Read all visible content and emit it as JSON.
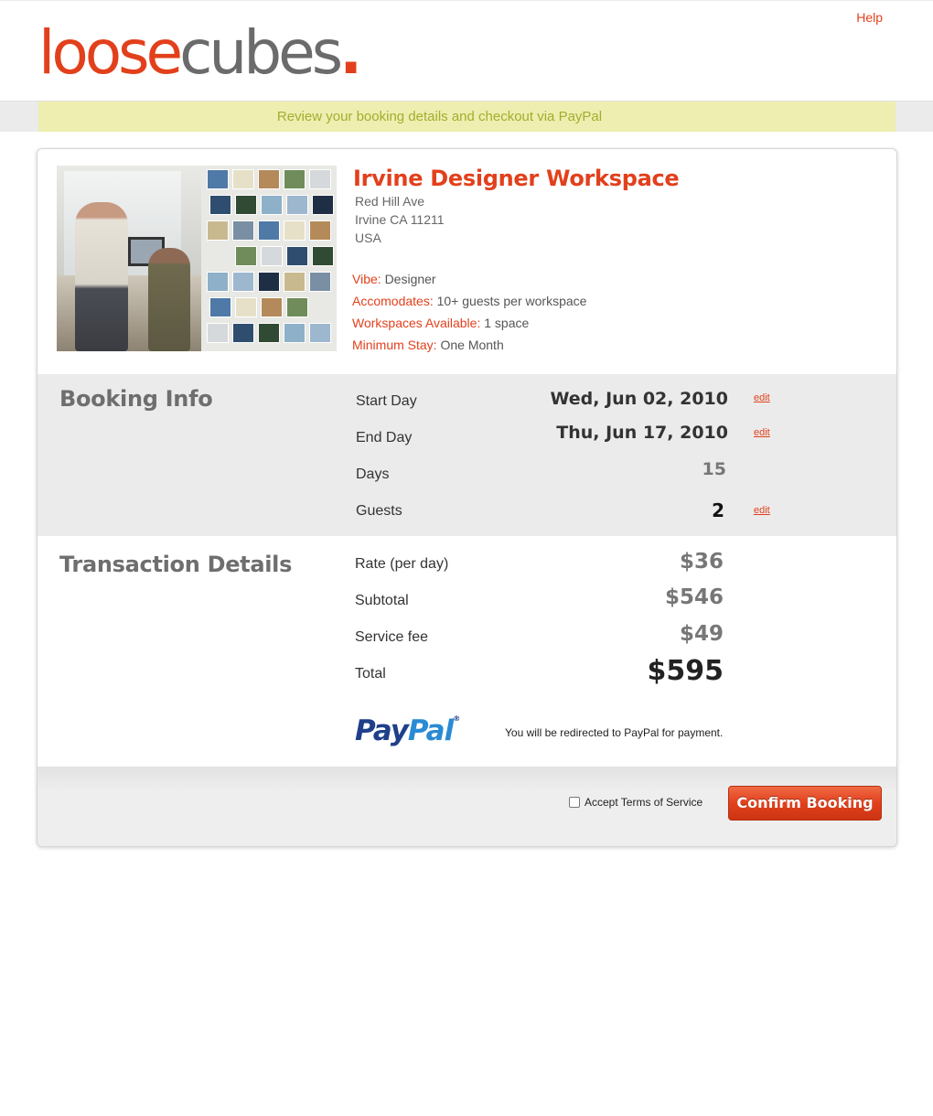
{
  "header": {
    "help_label": "Help",
    "logo": {
      "part1": "loose",
      "part2": "cubes",
      "dot": "."
    }
  },
  "notice": "Review your booking details and checkout via PayPal",
  "listing": {
    "title": "Irvine Designer Workspace",
    "address": [
      "Red Hill Ave",
      "Irvine CA 11211",
      "USA"
    ],
    "attributes": [
      {
        "key": "Vibe:",
        "value": "Designer"
      },
      {
        "key": "Accomodates:",
        "value": "10+ guests per workspace"
      },
      {
        "key": "Workspaces Available:",
        "value": "1 space"
      },
      {
        "key": "Minimum Stay:",
        "value": "One Month"
      }
    ]
  },
  "booking_info": {
    "heading": "Booking Info",
    "rows": [
      {
        "label": "Start Day",
        "value": "Wed, Jun 02, 2010",
        "edit": "edit"
      },
      {
        "label": "End Day",
        "value": "Thu, Jun 17, 2010",
        "edit": "edit"
      },
      {
        "label": "Days",
        "value": "15"
      },
      {
        "label": "Guests",
        "value": "2",
        "edit": "edit"
      }
    ]
  },
  "transaction": {
    "heading": "Transaction Details",
    "rows": [
      {
        "label": "Rate (per day)",
        "value": "$36"
      },
      {
        "label": "Subtotal",
        "value": "$546"
      },
      {
        "label": "Service fee",
        "value": "$49"
      },
      {
        "label": "Total",
        "value": "$595"
      }
    ]
  },
  "payment": {
    "logo": {
      "part1": "Pay",
      "part2": "Pal",
      "reg": "®"
    },
    "redirect_text": "You will be redirected to PayPal for payment."
  },
  "footer": {
    "tos_label": "Accept Terms of Service",
    "tos_checked": false,
    "confirm_label": "Confirm Booking"
  },
  "colors": {
    "accent": "#e2401c",
    "logo_gray": "#6b6b6b",
    "notice_bg": "#eeeeb0",
    "notice_text": "#a4ad2e",
    "paypal_dark": "#1f3f8a",
    "paypal_light": "#2a8ad4"
  }
}
